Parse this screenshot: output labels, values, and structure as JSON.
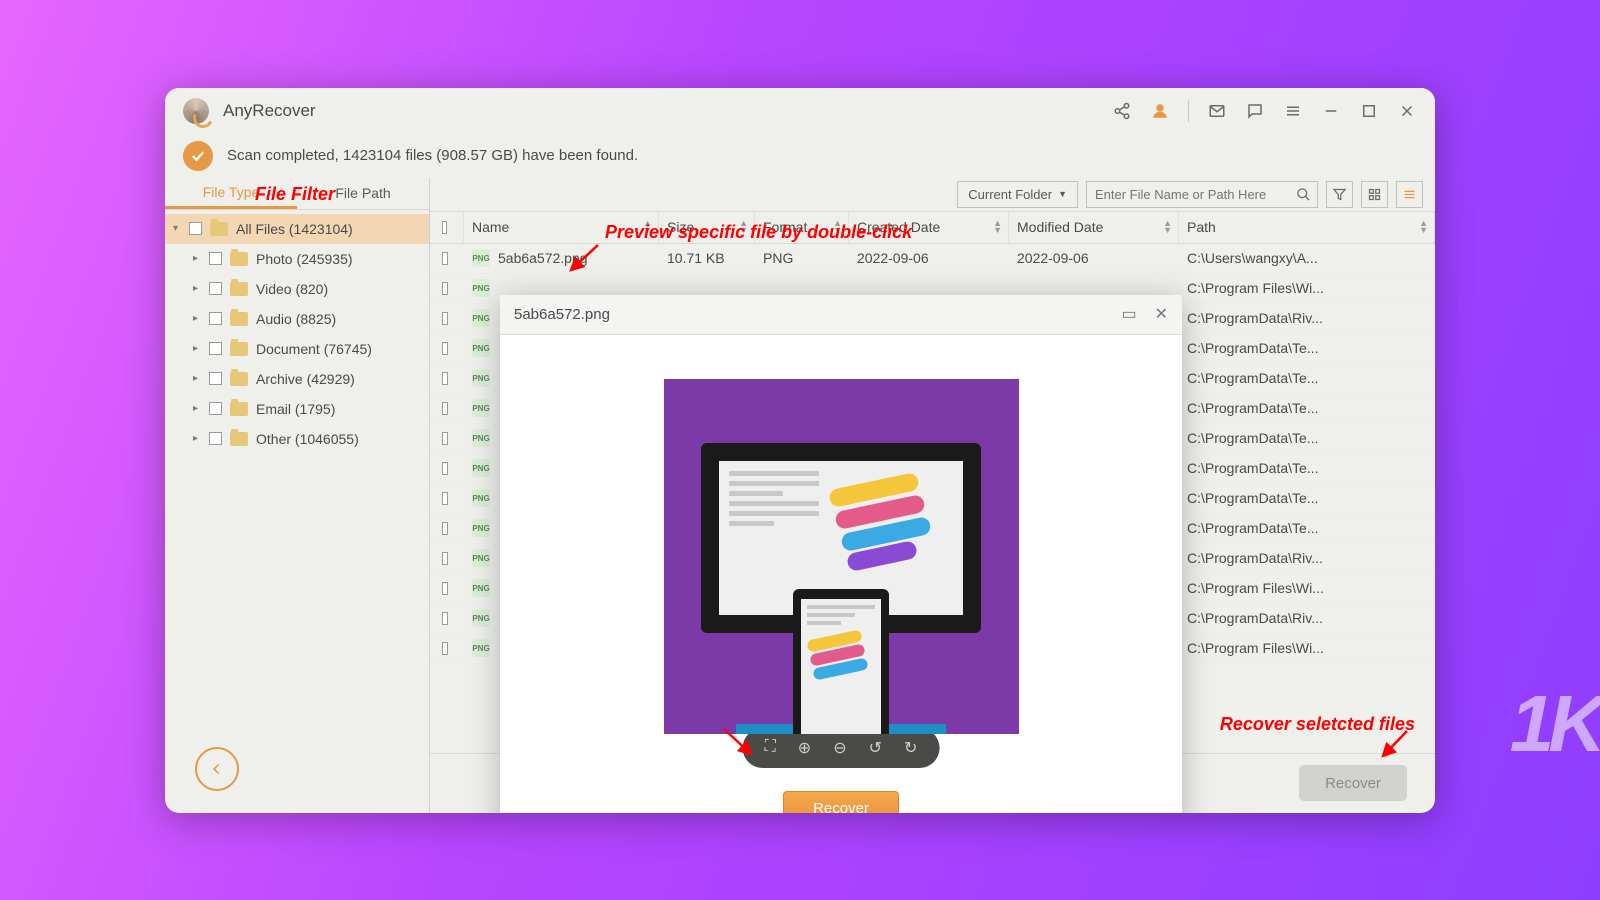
{
  "app_title": "AnyRecover",
  "status_text": "Scan completed, 1423104 files (908.57 GB) have been found.",
  "sidebar": {
    "tabs": [
      "File Type",
      "File Path"
    ],
    "items": [
      {
        "label": "All Files (1423104)"
      },
      {
        "label": "Photo (245935)"
      },
      {
        "label": "Video (820)"
      },
      {
        "label": "Audio (8825)"
      },
      {
        "label": "Document (76745)"
      },
      {
        "label": "Archive (42929)"
      },
      {
        "label": "Email (1795)"
      },
      {
        "label": "Other (1046055)"
      }
    ]
  },
  "toolbar": {
    "dropdown": "Current Folder",
    "search_placeholder": "Enter File Name or Path Here"
  },
  "columns": {
    "name": "Name",
    "size": "Size",
    "format": "Format",
    "created": "Created Date",
    "modified": "Modified Date",
    "path": "Path"
  },
  "rows": [
    {
      "name": "5ab6a572.png",
      "size": "10.71 KB",
      "format": "PNG",
      "created": "2022-09-06",
      "modified": "2022-09-06",
      "path": "C:\\Users\\wangxy\\A..."
    },
    {
      "name": "",
      "size": "",
      "format": "",
      "created": "",
      "modified": "",
      "path": "C:\\Program Files\\Wi..."
    },
    {
      "name": "",
      "size": "",
      "format": "",
      "created": "",
      "modified": "",
      "path": "C:\\ProgramData\\Riv..."
    },
    {
      "name": "",
      "size": "",
      "format": "",
      "created": "",
      "modified": "",
      "path": "C:\\ProgramData\\Te..."
    },
    {
      "name": "",
      "size": "",
      "format": "",
      "created": "",
      "modified": "",
      "path": "C:\\ProgramData\\Te..."
    },
    {
      "name": "",
      "size": "",
      "format": "",
      "created": "",
      "modified": "",
      "path": "C:\\ProgramData\\Te..."
    },
    {
      "name": "",
      "size": "",
      "format": "",
      "created": "",
      "modified": "",
      "path": "C:\\ProgramData\\Te..."
    },
    {
      "name": "",
      "size": "",
      "format": "",
      "created": "",
      "modified": "",
      "path": "C:\\ProgramData\\Te..."
    },
    {
      "name": "",
      "size": "",
      "format": "",
      "created": "",
      "modified": "",
      "path": "C:\\ProgramData\\Te..."
    },
    {
      "name": "",
      "size": "",
      "format": "",
      "created": "",
      "modified": "",
      "path": "C:\\ProgramData\\Te..."
    },
    {
      "name": "",
      "size": "",
      "format": "",
      "created": "",
      "modified": "",
      "path": "C:\\ProgramData\\Riv..."
    },
    {
      "name": "",
      "size": "",
      "format": "",
      "created": "",
      "modified": "",
      "path": "C:\\Program Files\\Wi..."
    },
    {
      "name": "",
      "size": "",
      "format": "",
      "created": "",
      "modified": "",
      "path": "C:\\ProgramData\\Riv..."
    },
    {
      "name": "",
      "size": "",
      "format": "",
      "created": "",
      "modified": "",
      "path": "C:\\Program Files\\Wi..."
    }
  ],
  "footer": {
    "recover": "Recover"
  },
  "preview": {
    "title": "5ab6a572.png",
    "recover": "Recover"
  },
  "annotations": {
    "filter": "File Filter",
    "preview": "Preview specific file by double-click",
    "recover": "Recover seletcted files"
  }
}
